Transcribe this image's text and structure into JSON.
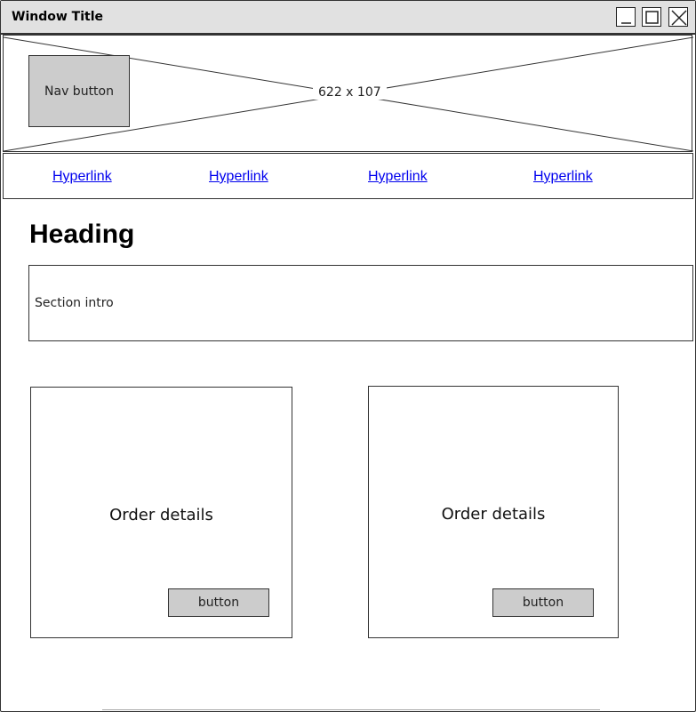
{
  "window": {
    "title": "Window Title",
    "controls": {
      "minimize_icon": "minimize-icon",
      "maximize_icon": "maximize-icon",
      "close_icon": "close-icon"
    }
  },
  "banner": {
    "placeholder_label": "622 x 107",
    "nav_button_label": "Nav button"
  },
  "nav": {
    "links": [
      "Hyperlink",
      "Hyperlink",
      "Hyperlink",
      "Hyperlink"
    ]
  },
  "main": {
    "heading": "Heading",
    "section_intro": "Section intro",
    "cards": [
      {
        "title": "Order details",
        "button_label": "button"
      },
      {
        "title": "Order details",
        "button_label": "button"
      }
    ]
  },
  "colors": {
    "titlebar_bg": "#e1e1e1",
    "button_fill": "#cccccc",
    "link_color": "#0000ee",
    "border": "#333333"
  }
}
